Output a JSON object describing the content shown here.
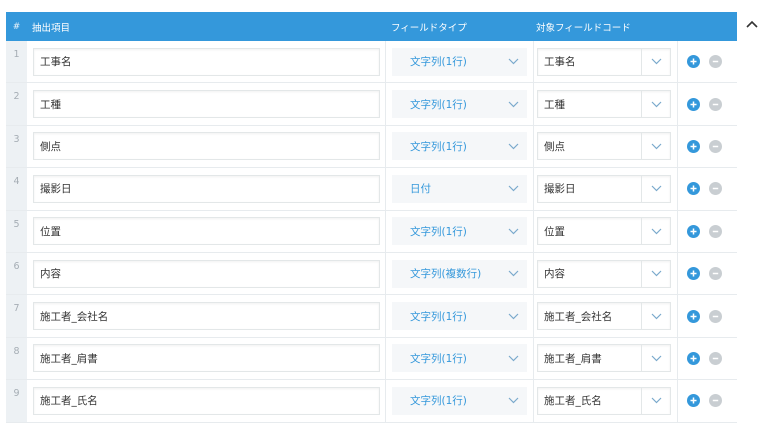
{
  "header": {
    "num": "#",
    "field": "抽出項目",
    "field_type": "フィールドタイプ",
    "target_field": "対象フィールドコード"
  },
  "rows": [
    {
      "num": "1",
      "name": "工事名",
      "type": "文字列(1行)",
      "target": "工事名"
    },
    {
      "num": "2",
      "name": "工種",
      "type": "文字列(1行)",
      "target": "工種"
    },
    {
      "num": "3",
      "name": "側点",
      "type": "文字列(1行)",
      "target": "側点"
    },
    {
      "num": "4",
      "name": "撮影日",
      "type": "日付",
      "target": "撮影日"
    },
    {
      "num": "5",
      "name": "位置",
      "type": "文字列(1行)",
      "target": "位置"
    },
    {
      "num": "6",
      "name": "内容",
      "type": "文字列(複数行)",
      "target": "内容"
    },
    {
      "num": "7",
      "name": "施工者_会社名",
      "type": "文字列(1行)",
      "target": "施工者_会社名"
    },
    {
      "num": "8",
      "name": "施工者_肩書",
      "type": "文字列(1行)",
      "target": "施工者_肩書"
    },
    {
      "num": "9",
      "name": "施工者_氏名",
      "type": "文字列(1行)",
      "target": "施工者_氏名"
    }
  ],
  "icons": {
    "add": "plus-circle-icon",
    "remove": "minus-circle-icon",
    "dropdown": "chevron-down-icon",
    "collapse": "chevron-up-icon"
  },
  "colors": {
    "accent": "#3498db",
    "row_number_bg": "#edf1f4",
    "remove_button": "#c9ced2"
  }
}
